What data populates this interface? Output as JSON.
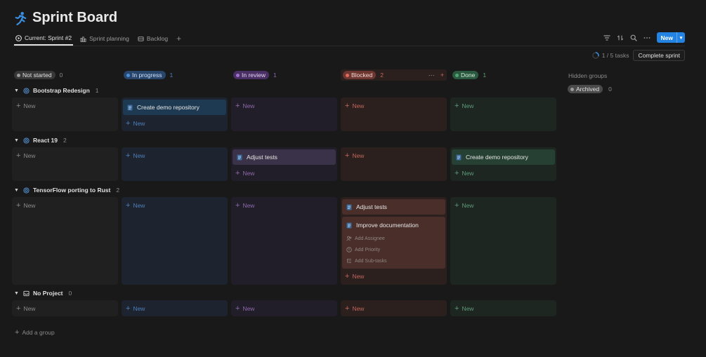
{
  "page": {
    "title": "Sprint Board",
    "icon": "running-person-icon"
  },
  "tabs": [
    {
      "label": "Current: Sprint #2",
      "icon": "play-circle-icon",
      "active": true
    },
    {
      "label": "Sprint planning",
      "icon": "chart-icon",
      "active": false
    },
    {
      "label": "Backlog",
      "icon": "stack-icon",
      "active": false
    }
  ],
  "toolbar": {
    "new_label": "New",
    "icons": [
      "filter-icon",
      "sort-icon",
      "search-icon",
      "more-icon"
    ]
  },
  "sprint": {
    "progress_text": "1 / 5 tasks",
    "complete_label": "Complete sprint"
  },
  "columns": [
    {
      "label": "Not started",
      "count": "0",
      "pill_bg": "#373737",
      "dot": "#9b9b9b",
      "text": "#e3e3e3",
      "cell_bg": "#202020",
      "new_color": "#8a8a8a"
    },
    {
      "label": "In progress",
      "count": "1",
      "pill_bg": "#28456c",
      "dot": "#4a8fd9",
      "text": "#cfe1f8",
      "cell_bg": "#1d2430",
      "new_color": "#4e7fb8"
    },
    {
      "label": "In review",
      "count": "1",
      "pill_bg": "#492f64",
      "dot": "#a070cf",
      "text": "#e1d4f0",
      "cell_bg": "#221e29",
      "new_color": "#8c6aac"
    },
    {
      "label": "Blocked",
      "count": "2",
      "pill_bg": "#6e3630",
      "dot": "#e06c5f",
      "text": "#f5d8d4",
      "cell_bg": "#2b201e",
      "new_color": "#c0665c"
    },
    {
      "label": "Done",
      "count": "1",
      "pill_bg": "#2b593f",
      "dot": "#52a374",
      "text": "#d3ebdc",
      "cell_bg": "#1e2622",
      "new_color": "#5f9a76"
    }
  ],
  "card_bgs": [
    "#2a2a2a",
    "#1e3a52",
    "#3a3248",
    "#4a2e2a",
    "#264034"
  ],
  "hidden_groups": {
    "label": "Hidden groups",
    "archived_label": "Archived",
    "archived_count": "0"
  },
  "groups": [
    {
      "name": "Bootstrap Redesign",
      "count": "1",
      "icon": "target-icon"
    },
    {
      "name": "React 19",
      "count": "2",
      "icon": "target-icon"
    },
    {
      "name": "TensorFlow porting to Rust",
      "count": "2",
      "icon": "target-icon"
    },
    {
      "name": "No Project",
      "count": "0",
      "icon": "inbox-icon"
    }
  ],
  "cards": {
    "g0_inprogress": "Create demo repository",
    "g1_inreview": "Adjust tests",
    "g1_done": "Create demo repository",
    "g2_blocked_1": "Adjust tests",
    "g2_blocked_2": "Improve documentation"
  },
  "card_props": [
    "Add Assignee",
    "Add Priority",
    "Add Sub-tasks"
  ],
  "new_label": "New",
  "add_group_label": "Add a group"
}
